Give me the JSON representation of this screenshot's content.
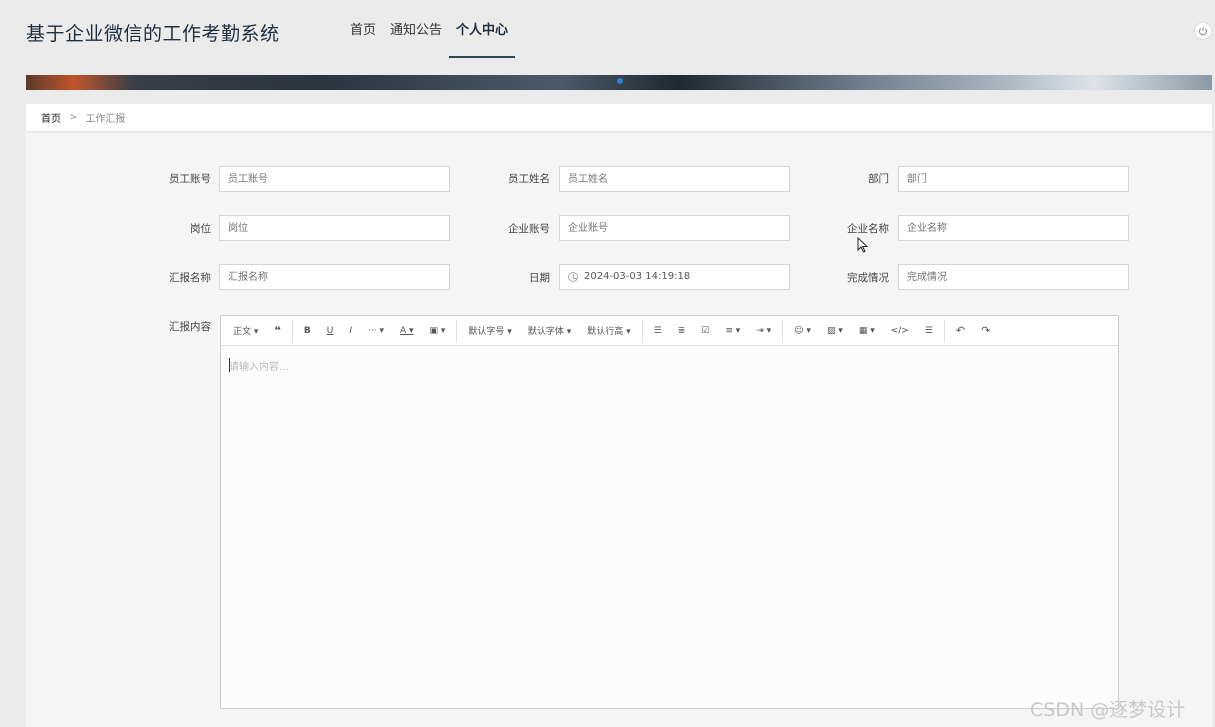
{
  "header": {
    "title": "基于企业微信的工作考勤系统",
    "nav": [
      {
        "label": "首页"
      },
      {
        "label": "通知公告"
      },
      {
        "label": "个人中心"
      }
    ]
  },
  "breadcrumb": {
    "home": "首页",
    "separator": ">",
    "current": "工作汇报"
  },
  "form": {
    "fields": [
      {
        "label": "员工账号",
        "placeholder": "员工账号"
      },
      {
        "label": "员工姓名",
        "placeholder": "员工姓名"
      },
      {
        "label": "部门",
        "placeholder": "部门"
      },
      {
        "label": "岗位",
        "placeholder": "岗位"
      },
      {
        "label": "企业账号",
        "placeholder": "企业账号"
      },
      {
        "label": "企业名称",
        "placeholder": "企业名称"
      },
      {
        "label": "汇报名称",
        "placeholder": "汇报名称"
      },
      {
        "label": "日期",
        "value": "2024-03-03 14:19:18"
      },
      {
        "label": "完成情况",
        "placeholder": "完成情况"
      }
    ],
    "content_label": "汇报内容"
  },
  "editor": {
    "toolbar": {
      "paragraph": "正文",
      "font_size": "默认字号",
      "font_family": "默认字体",
      "line_height": "默认行高"
    },
    "placeholder": "请输入内容..."
  },
  "watermark": "CSDN @逐梦设计",
  "colors": {
    "active_nav_underline": "#2c4a5a",
    "banner_indicator": "#2f7fd0"
  }
}
